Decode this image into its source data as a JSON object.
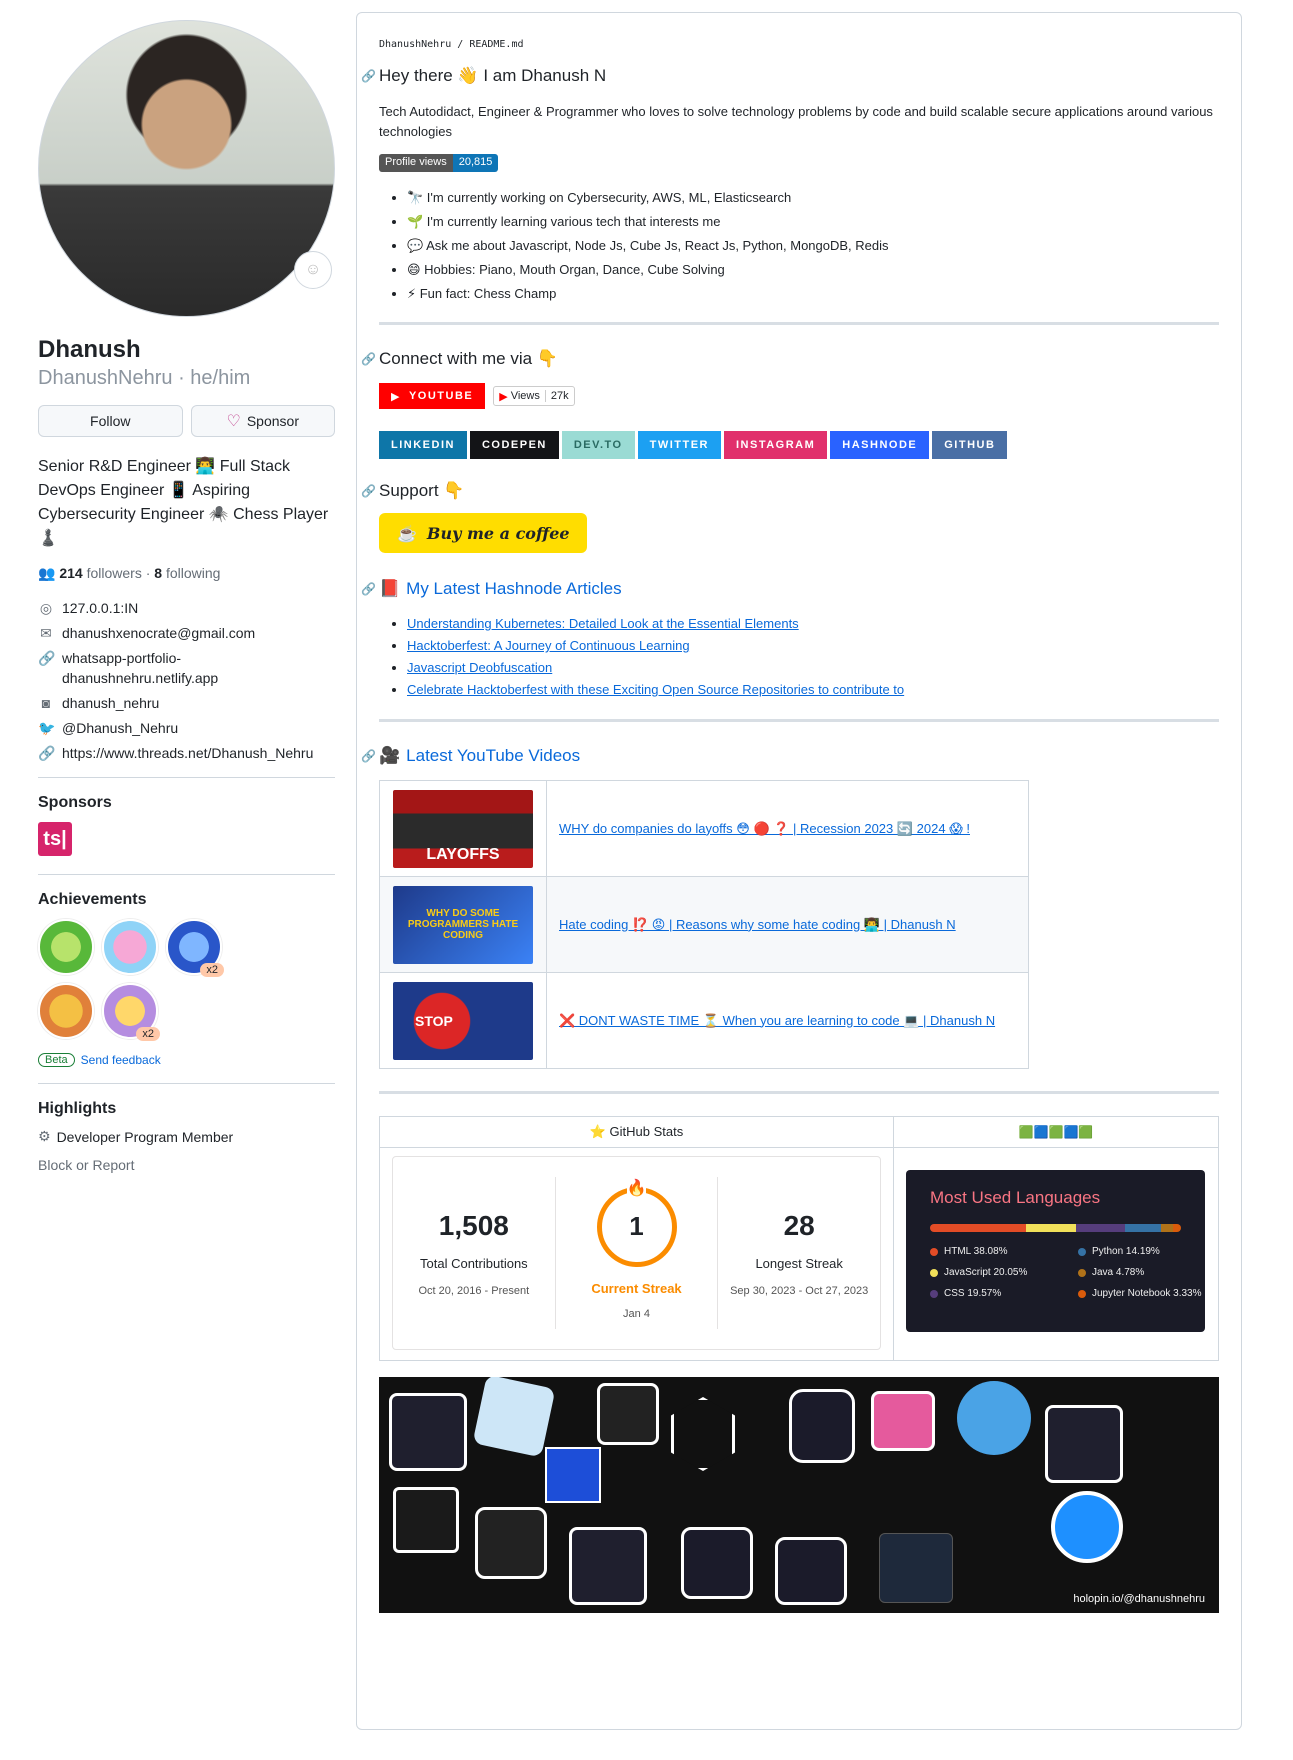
{
  "profile": {
    "name": "Dhanush",
    "login": "DhanushNehru · he/him",
    "follow_label": "Follow",
    "sponsor_label": "Sponsor",
    "bio_lines": [
      "Senior R&D Engineer 👨‍💻 Full Stack",
      "DevOps Engineer 📱 Aspiring",
      "Cybersecurity Engineer 🕷️ Chess Player",
      "♟️"
    ],
    "followers": "214",
    "followers_label": "followers",
    "following": "8",
    "following_label": "following",
    "location": "127.0.0.1:IN",
    "email": "dhanushxenocrate@gmail.com",
    "website_line1": "whatsapp-portfolio-",
    "website_line2": "dhanushnehru.netlify.app",
    "instagram": "dhanush_nehru",
    "twitter": "@Dhanush_Nehru",
    "threads": "https://www.threads.net/Dhanush_Nehru",
    "sponsors_title": "Sponsors",
    "sponsor_logo_text": "ts|",
    "achievements_title": "Achievements",
    "achievement_count_1": "x2",
    "achievement_count_2": "x2",
    "beta": "Beta",
    "send_feedback": "Send feedback",
    "highlights_title": "Highlights",
    "highlight_item": "Developer Program Member",
    "block_report": "Block or Report"
  },
  "readme": {
    "breadcrumb_user": "DhanushNehru",
    "breadcrumb_sep": " / ",
    "breadcrumb_file": "README.md",
    "greeting": "Hey there 👋 I am Dhanush N",
    "intro": "Tech Autodidact, Engineer & Programmer who loves to solve technology problems by code and build scalable secure applications around various technologies",
    "views_label": "Profile views",
    "views_value": "20,815",
    "facts": [
      "🔭 I'm currently working on Cybersecurity, AWS, ML, Elasticsearch",
      "🌱 I'm currently learning various tech that interests me",
      "💬 Ask me about Javascript, Node Js, Cube Js, React Js, Python, MongoDB, Redis",
      "😄 Hobbies: Piano, Mouth Organ, Dance, Cube Solving",
      "⚡ Fun fact: Chess Champ"
    ],
    "connect_title": "Connect with me via 👇",
    "youtube_label": "YOUTUBE",
    "yt_views_label": "Views",
    "yt_views_value": "27k",
    "socials": [
      "LINKEDIN",
      "CODEPEN",
      "DEV.TO",
      "TWITTER",
      "INSTAGRAM",
      "HASHNODE",
      "GITHUB"
    ],
    "support_title": "Support 👇",
    "coffee_label": "Buy me a coffee",
    "articles_title": "My Latest Hashnode Articles",
    "articles": [
      "Understanding Kubernetes: Detailed Look at the Essential Elements",
      "Hacktoberfest: A Journey of Continuous Learning",
      "Javascript Deobfuscation",
      "Celebrate Hacktoberfest with these Exciting Open Source Repositories to contribute to"
    ],
    "videos_title": "Latest YouTube Videos",
    "videos": [
      {
        "title": "WHY do companies do layoffs 😳 🔴 ❓ | Recession 2023 🔄 2024 😱 !",
        "thumb_text": "LAYOFFS"
      },
      {
        "title": "Hate coding ⁉️ 😡 | Reasons why some hate coding 👨‍💻 | Dhanush N",
        "thumb_text": "WHY DO SOME PROGRAMMERS HATE CODING"
      },
      {
        "title": "❌ DONT WASTE TIME ⏳ When you are learning to code 💻 | Dhanush N",
        "thumb_text": "STOP"
      }
    ],
    "github_stats_label": "⭐ GitHub Stats",
    "streak": {
      "total_value": "1,508",
      "total_label": "Total Contributions",
      "total_range": "Oct 20, 2016 - Present",
      "current_value": "1",
      "current_label": "Current Streak",
      "current_date": "Jan 4",
      "longest_value": "28",
      "longest_label": "Longest Streak",
      "longest_range": "Sep 30, 2023 - Oct 27, 2023"
    },
    "languages": {
      "title": "Most Used Languages",
      "items": [
        {
          "name": "HTML 38.08%",
          "color": "#e34c26",
          "pct": 38.08
        },
        {
          "name": "JavaScript 20.05%",
          "color": "#f1e05a",
          "pct": 20.05
        },
        {
          "name": "CSS 19.57%",
          "color": "#563d7c",
          "pct": 19.57
        },
        {
          "name": "Python 14.19%",
          "color": "#3572a5",
          "pct": 14.19
        },
        {
          "name": "Java 4.78%",
          "color": "#b07219",
          "pct": 4.78
        },
        {
          "name": "Jupyter Notebook 3.33%",
          "color": "#da5b0b",
          "pct": 3.33
        }
      ]
    },
    "holopin_label": "holopin.io/@dhanushnehru"
  },
  "colors": {
    "accent": "#0969da",
    "youtube": "#ff0000",
    "linkedin": "#0e76a8",
    "codepen": "#131417",
    "devto": "#9adbd4",
    "twitter": "#1ca0f2",
    "instagram": "#e1306c",
    "hashnode": "#2962ff",
    "github": "#4a6fa5",
    "coffee": "#ffdd00",
    "streak": "#fb8c00"
  }
}
